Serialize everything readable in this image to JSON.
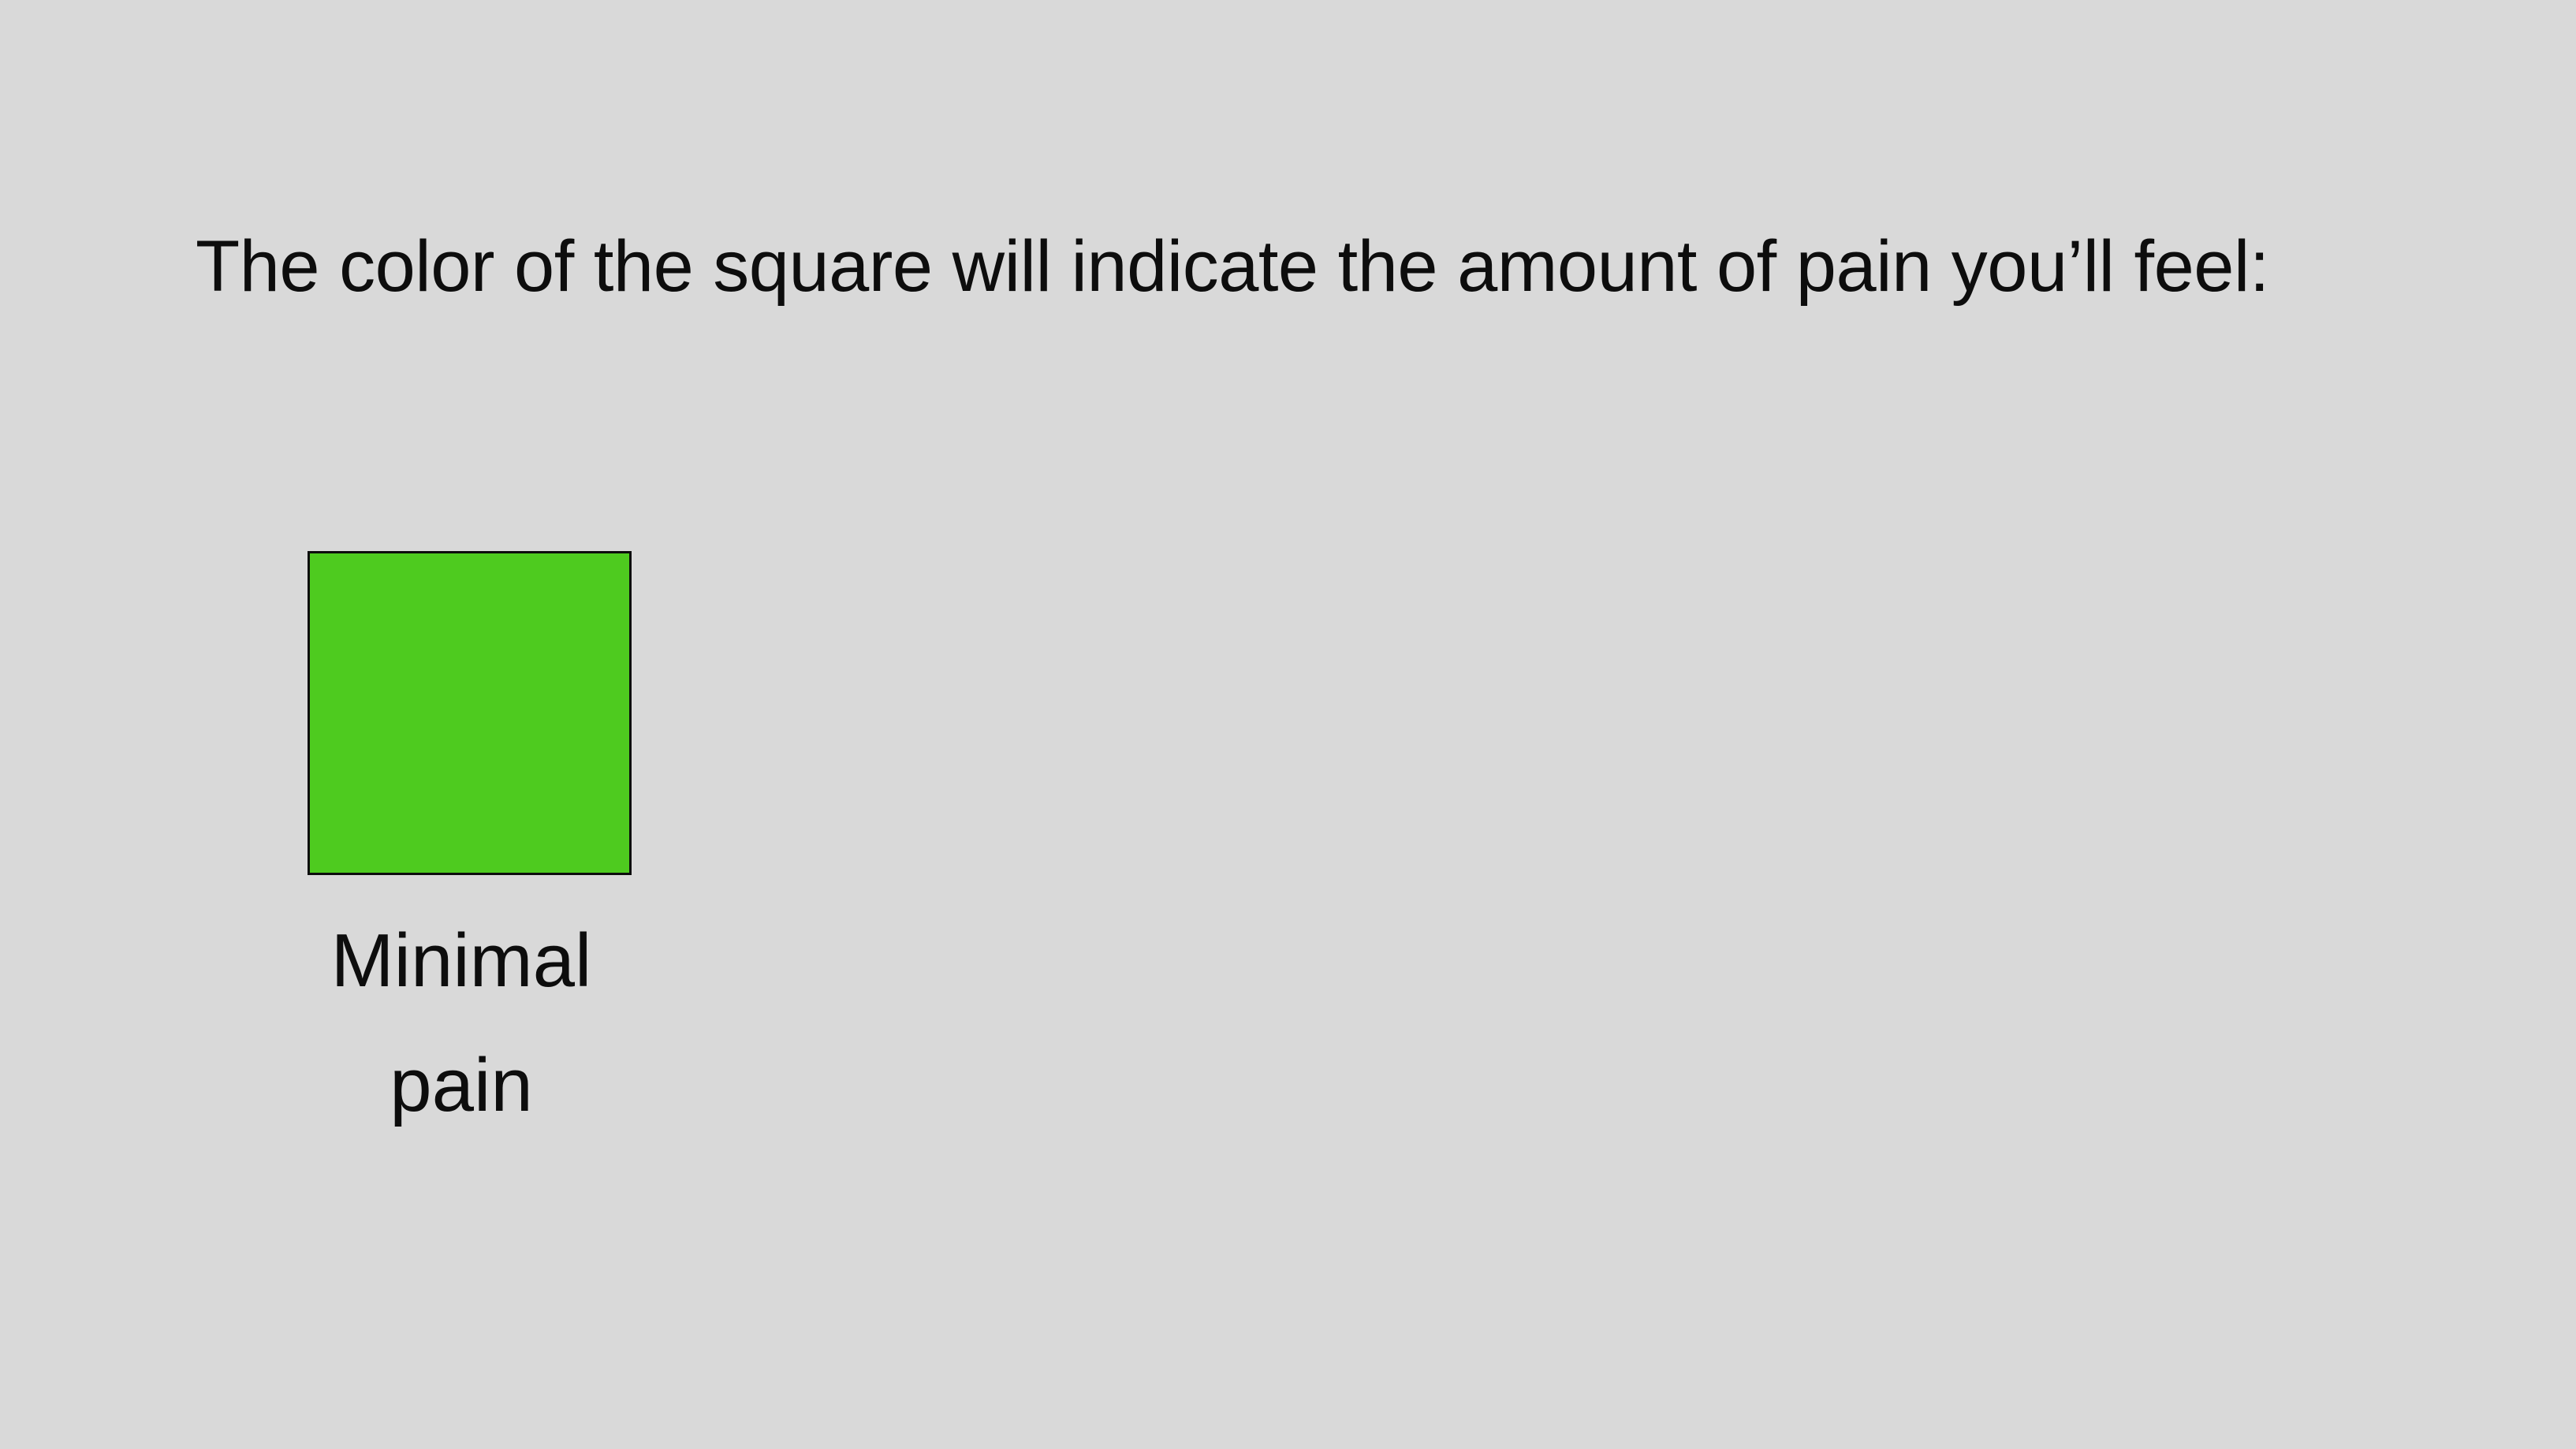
{
  "slide": {
    "background_color": "#d9d9d9",
    "instruction_text": "The color of the square will indicate the amount of pain you’ll feel:",
    "square": {
      "color": "#4ecb1f",
      "label_line1": "Minimal",
      "label_line2": "pain"
    }
  }
}
